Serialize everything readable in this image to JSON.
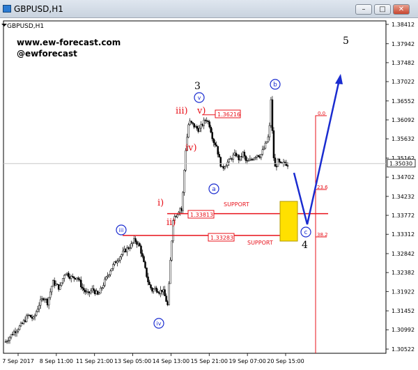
{
  "window": {
    "title": "GBPUSD,H1",
    "minimize_glyph": "–",
    "maximize_glyph": "□",
    "close_glyph": "✕"
  },
  "watermark": {
    "site": "www.ew-forecast.com",
    "handle": "@ewforecast"
  },
  "chart_data": {
    "type": "candlestick",
    "title": "GBPUSD,H1",
    "y_ticks": [
      "1.38412",
      "1.37942",
      "1.37482",
      "1.37022",
      "1.36552",
      "1.36092",
      "1.35632",
      "1.35162",
      "1.34702",
      "1.34232",
      "1.33772",
      "1.33312",
      "1.32842",
      "1.32382",
      "1.31922",
      "1.31452",
      "1.30992",
      "1.30522"
    ],
    "ylim": [
      1.30522,
      1.38412
    ],
    "x_ticks": [
      "7 Sep 2017",
      "8 Sep 11:00",
      "11 Sep 21:00",
      "13 Sep 05:00",
      "14 Sep 13:00",
      "15 Sep 21:00",
      "19 Sep 07:00",
      "20 Sep 15:00"
    ],
    "current_price": "1.35030",
    "color_up": "#000000",
    "color_down": "#000000",
    "price_path": [
      [
        0,
        1.307
      ],
      [
        5,
        1.3095
      ],
      [
        9,
        1.311
      ],
      [
        13,
        1.3135
      ],
      [
        16,
        1.3125
      ],
      [
        19,
        1.316
      ],
      [
        22,
        1.318
      ],
      [
        24,
        1.3165
      ],
      [
        27,
        1.3215
      ],
      [
        31,
        1.32
      ],
      [
        34,
        1.324
      ],
      [
        38,
        1.3225
      ],
      [
        41,
        1.3228
      ],
      [
        44,
        1.32
      ],
      [
        47,
        1.3185
      ],
      [
        50,
        1.3198
      ],
      [
        53,
        1.3182
      ],
      [
        56,
        1.321
      ],
      [
        60,
        1.3245
      ],
      [
        64,
        1.327
      ],
      [
        68,
        1.329
      ],
      [
        72,
        1.3305
      ],
      [
        74,
        1.3318
      ],
      [
        77,
        1.33
      ],
      [
        80,
        1.3245
      ],
      [
        82,
        1.321
      ],
      [
        84,
        1.3195
      ],
      [
        86,
        1.32
      ],
      [
        88,
        1.3192
      ],
      [
        90,
        1.3196
      ],
      [
        92,
        1.317
      ],
      [
        93,
        1.3155
      ],
      [
        94,
        1.324
      ],
      [
        96,
        1.337
      ],
      [
        98,
        1.338
      ],
      [
        100,
        1.3395
      ],
      [
        101,
        1.3388
      ],
      [
        103,
        1.353
      ],
      [
        105,
        1.3605
      ],
      [
        107,
        1.3598
      ],
      [
        109,
        1.359
      ],
      [
        111,
        1.3585
      ],
      [
        113,
        1.36
      ],
      [
        115,
        1.3612
      ],
      [
        117,
        1.3595
      ],
      [
        119,
        1.3558
      ],
      [
        121,
        1.3545
      ],
      [
        122,
        1.352
      ],
      [
        124,
        1.349
      ],
      [
        126,
        1.3502
      ],
      [
        128,
        1.3508
      ],
      [
        130,
        1.352
      ],
      [
        132,
        1.3525
      ],
      [
        134,
        1.3512
      ],
      [
        136,
        1.3528
      ],
      [
        138,
        1.3505
      ],
      [
        140,
        1.351
      ],
      [
        142,
        1.3518
      ],
      [
        144,
        1.3525
      ],
      [
        146,
        1.3522
      ],
      [
        148,
        1.354
      ],
      [
        150,
        1.356
      ],
      [
        151,
        1.3575
      ],
      [
        152,
        1.366
      ],
      [
        153,
        1.356
      ],
      [
        154,
        1.349
      ],
      [
        156,
        1.3508
      ],
      [
        158,
        1.3498
      ],
      [
        160,
        1.3505
      ],
      [
        162,
        1.35
      ]
    ],
    "x_span": [
      0,
      162
    ],
    "annotations": {
      "wave_3": "3",
      "wave_4": "4",
      "wave_5": "5",
      "wave_i": "i)",
      "wave_ii": "ii)",
      "wave_iii_red": "iii)",
      "wave_iv_red": "iv)",
      "wave_v_red": "v)",
      "circ_iii": "iii",
      "circ_iv": "iv",
      "circ_v": "v",
      "circ_a": "a",
      "circ_b": "b",
      "circ_c": "c",
      "box_136216": "1.36216",
      "box_133813": "1.33813",
      "box_133283": "1.33283",
      "support_1": "SUPPORT",
      "support_2": "SUPPORT",
      "fib_0": "0.0",
      "fib_236": "23.6",
      "fib_382": "38.2"
    },
    "levels": {
      "res_1": 1.36216,
      "sup_1": 1.33813,
      "sup_2": 1.33283
    },
    "colors": {
      "red": "#e8111a",
      "blue": "#1a2cd0",
      "yellow": "#ffe000",
      "bg": "#ffffff",
      "grid": "#c8c8c8"
    }
  }
}
